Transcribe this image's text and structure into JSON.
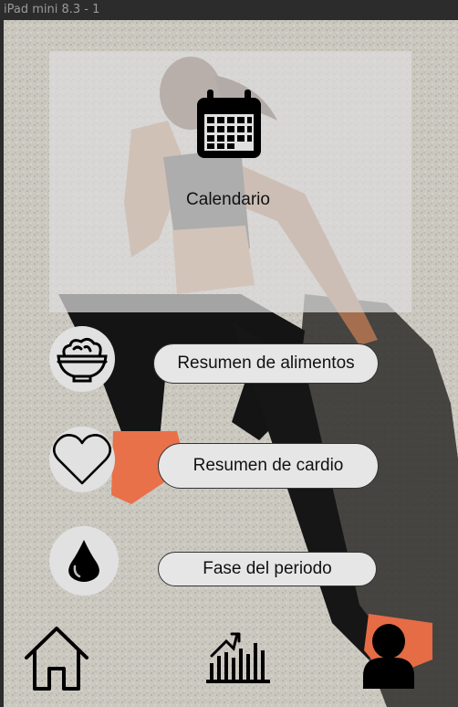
{
  "frame_title": "iPad mini 8.3 - 1",
  "calendar": {
    "label": "Calendario",
    "icon": "calendar-icon"
  },
  "menu": [
    {
      "label": "Resumen de alimentos",
      "icon": "salad-bowl-icon"
    },
    {
      "label": "Resumen de cardio",
      "icon": "heart-icon"
    },
    {
      "label": "Fase del periodo",
      "icon": "drop-icon"
    }
  ],
  "nav": [
    {
      "icon": "home-icon"
    },
    {
      "icon": "stats-chart-icon"
    },
    {
      "icon": "user-icon"
    }
  ],
  "colors": {
    "card": "#dcdcdc",
    "circle": "#e1e1e1",
    "pill": "#e6e6e6",
    "icon": "#000000"
  }
}
